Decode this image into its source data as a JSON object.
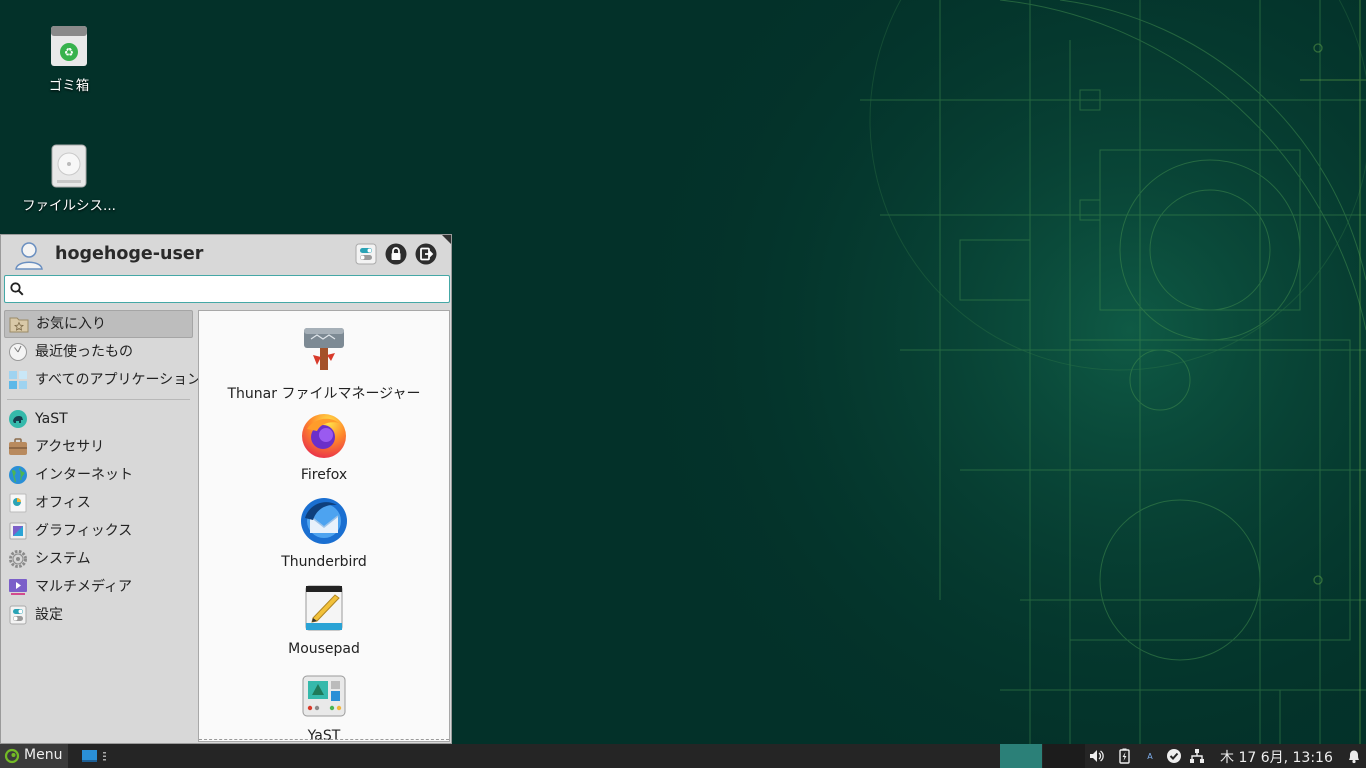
{
  "desktop": {
    "icons": [
      {
        "label": "ゴミ箱",
        "icon": "trash-icon"
      },
      {
        "label": "ファイルシス...",
        "icon": "drive-icon"
      }
    ]
  },
  "whisker_menu": {
    "user_name": "hogehoge-user",
    "header_buttons": [
      "settings-icon",
      "lock-icon",
      "logout-icon"
    ],
    "search": {
      "placeholder": "",
      "value": ""
    },
    "categories_top": [
      {
        "label": "お気に入り",
        "icon": "favorites-icon",
        "selected": true
      },
      {
        "label": "最近使ったもの",
        "icon": "recent-icon",
        "selected": false
      },
      {
        "label": "すべてのアプリケーション",
        "icon": "all-apps-icon",
        "selected": false
      }
    ],
    "categories": [
      {
        "label": "YaST",
        "icon": "yast-icon"
      },
      {
        "label": "アクセサリ",
        "icon": "accessories-icon"
      },
      {
        "label": "インターネット",
        "icon": "internet-icon"
      },
      {
        "label": "オフィス",
        "icon": "office-icon"
      },
      {
        "label": "グラフィックス",
        "icon": "graphics-icon"
      },
      {
        "label": "システム",
        "icon": "system-icon"
      },
      {
        "label": "マルチメディア",
        "icon": "multimedia-icon"
      },
      {
        "label": "設定",
        "icon": "settings-category-icon"
      }
    ],
    "favorites": [
      {
        "label": "Thunar ファイルマネージャー",
        "icon": "thunar-icon"
      },
      {
        "label": "Firefox",
        "icon": "firefox-icon"
      },
      {
        "label": "Thunderbird",
        "icon": "thunderbird-icon"
      },
      {
        "label": "Mousepad",
        "icon": "mousepad-icon"
      },
      {
        "label": "YaST",
        "icon": "yast-icon"
      }
    ]
  },
  "taskbar": {
    "menu_label": "Menu",
    "tray_icons": [
      "volume-icon",
      "battery-icon",
      "keyboard-indicator-icon",
      "update-check-icon",
      "network-icon",
      "notification-bell-icon"
    ],
    "clock": "木 17  6月, 13:16"
  },
  "colors": {
    "desktop_bg": "#033129",
    "accent": "#73ba25",
    "workspace_active": "#2b8078"
  }
}
